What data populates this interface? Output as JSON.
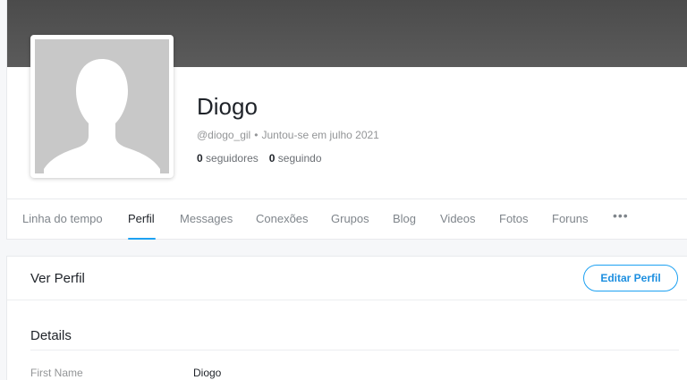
{
  "profile": {
    "name": "Diogo",
    "handle": "@diogo_gil",
    "separator": "•",
    "joined": "Juntou-se em julho 2021",
    "followers_count": "0",
    "followers_label": "seguidores",
    "following_count": "0",
    "following_label": "seguindo",
    "avatar_icon": "default-user-silhouette-icon"
  },
  "tabs": [
    {
      "label": "Linha do tempo",
      "active": false
    },
    {
      "label": "Perfil",
      "active": true
    },
    {
      "label": "Messages",
      "active": false
    },
    {
      "label": "Conexões",
      "active": false
    },
    {
      "label": "Grupos",
      "active": false
    },
    {
      "label": "Blog",
      "active": false
    },
    {
      "label": "Videos",
      "active": false
    },
    {
      "label": "Fotos",
      "active": false
    },
    {
      "label": "Foruns",
      "active": false
    }
  ],
  "more_tabs": {
    "label": "•••",
    "icon": "more-dots-icon"
  },
  "details_card": {
    "title": "Ver Perfil",
    "edit_button": "Editar Perfil",
    "section_title": "Details",
    "fields": [
      {
        "label": "First Name",
        "value": "Diogo"
      }
    ]
  },
  "colors": {
    "accent": "#1da1f2",
    "cover": "#555555",
    "avatar_bg": "#c8c8c8"
  }
}
